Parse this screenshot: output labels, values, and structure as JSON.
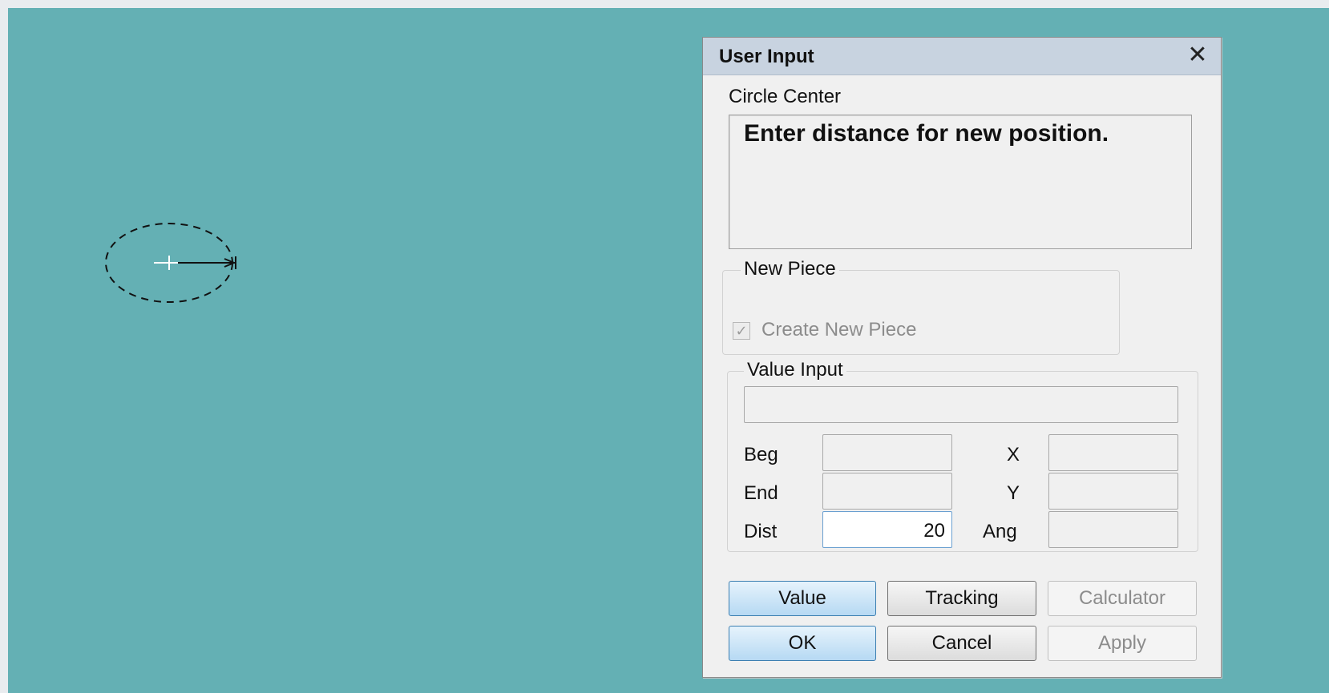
{
  "dialog": {
    "title": "User Input",
    "close_glyph": "✕",
    "caption": "Circle Center",
    "prompt": "Enter distance for new position."
  },
  "new_piece": {
    "legend": "New Piece",
    "checkbox_label": "Create New Piece",
    "checked": true
  },
  "value_input": {
    "legend": "Value Input",
    "main_value": "",
    "beg_label": "Beg",
    "beg_value": "",
    "end_label": "End",
    "end_value": "",
    "dist_label": "Dist",
    "dist_value": "20",
    "x_label": "X",
    "x_value": "",
    "y_label": "Y",
    "y_value": "",
    "ang_label": "Ang",
    "ang_value": ""
  },
  "buttons": {
    "value": "Value",
    "tracking": "Tracking",
    "calculator": "Calculator",
    "ok": "OK",
    "cancel": "Cancel",
    "apply": "Apply"
  },
  "colors": {
    "canvas_background": "#64b0b4",
    "dialog_title_bar": "#c8d3e0",
    "primary_button": "#b6d9f3"
  }
}
